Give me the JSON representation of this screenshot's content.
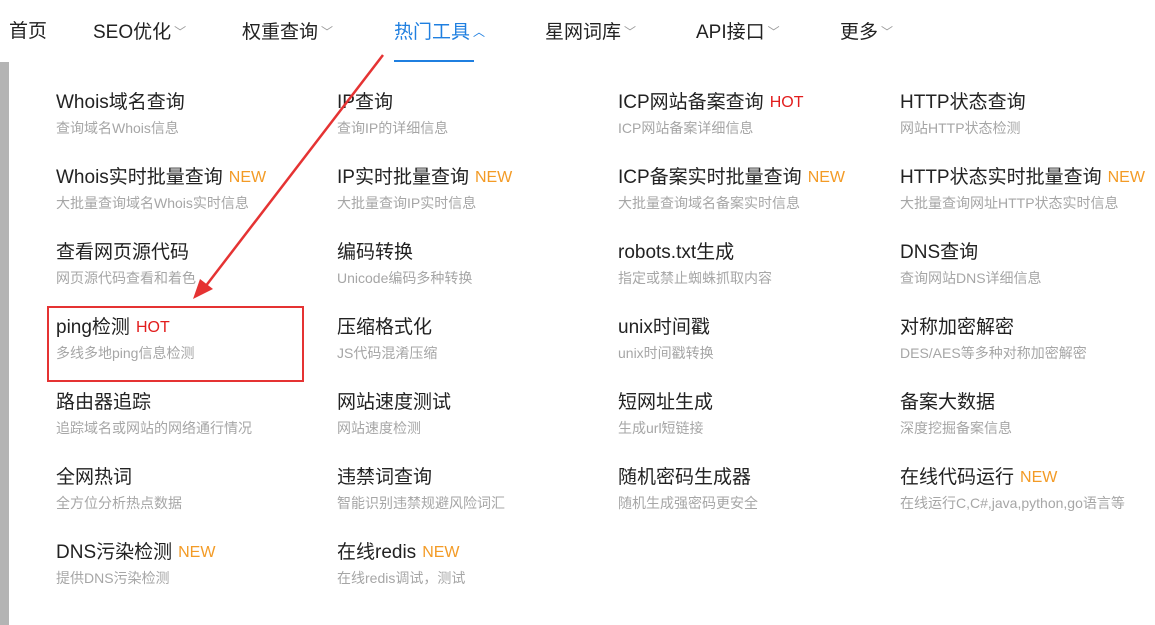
{
  "nav": {
    "items": [
      {
        "label": "首页",
        "chevron": ""
      },
      {
        "label": "SEO优化",
        "chevron": "﹀"
      },
      {
        "label": "权重查询",
        "chevron": "﹀"
      },
      {
        "label": "热门工具",
        "chevron": "︿"
      },
      {
        "label": "星网词库",
        "chevron": "﹀"
      },
      {
        "label": "API接口",
        "chevron": "﹀"
      },
      {
        "label": "更多",
        "chevron": "﹀"
      }
    ],
    "active": "热门工具"
  },
  "tools": [
    {
      "title": "Whois域名查询",
      "badge": "",
      "desc": "查询域名Whois信息"
    },
    {
      "title": "IP查询",
      "badge": "",
      "desc": "查询IP的详细信息"
    },
    {
      "title": "ICP网站备案查询",
      "badge": "HOT",
      "desc": "ICP网站备案详细信息"
    },
    {
      "title": "HTTP状态查询",
      "badge": "",
      "desc": "网站HTTP状态检测"
    },
    {
      "title": "Whois实时批量查询",
      "badge": "NEW",
      "desc": "大批量查询域名Whois实时信息"
    },
    {
      "title": "IP实时批量查询",
      "badge": "NEW",
      "desc": "大批量查询IP实时信息"
    },
    {
      "title": "ICP备案实时批量查询",
      "badge": "NEW",
      "desc": "大批量查询域名备案实时信息"
    },
    {
      "title": "HTTP状态实时批量查询",
      "badge": "NEW",
      "desc": "大批量查询网址HTTP状态实时信息"
    },
    {
      "title": "查看网页源代码",
      "badge": "",
      "desc": "网页源代码查看和着色"
    },
    {
      "title": "编码转换",
      "badge": "",
      "desc": "Unicode编码多种转换"
    },
    {
      "title": "robots.txt生成",
      "badge": "",
      "desc": "指定或禁止蜘蛛抓取内容"
    },
    {
      "title": "DNS查询",
      "badge": "",
      "desc": "查询网站DNS详细信息"
    },
    {
      "title": "ping检测",
      "badge": "HOT",
      "desc": "多线多地ping信息检测"
    },
    {
      "title": "压缩格式化",
      "badge": "",
      "desc": "JS代码混淆压缩"
    },
    {
      "title": "unix时间戳",
      "badge": "",
      "desc": "unix时间戳转换"
    },
    {
      "title": "对称加密解密",
      "badge": "",
      "desc": "DES/AES等多种对称加密解密"
    },
    {
      "title": "路由器追踪",
      "badge": "",
      "desc": "追踪域名或网站的网络通行情况"
    },
    {
      "title": "网站速度测试",
      "badge": "",
      "desc": "网站速度检测"
    },
    {
      "title": "短网址生成",
      "badge": "",
      "desc": "生成url短链接"
    },
    {
      "title": "备案大数据",
      "badge": "",
      "desc": "深度挖掘备案信息"
    },
    {
      "title": "全网热词",
      "badge": "",
      "desc": "全方位分析热点数据"
    },
    {
      "title": "违禁词查询",
      "badge": "",
      "desc": "智能识别违禁规避风险词汇"
    },
    {
      "title": "随机密码生成器",
      "badge": "",
      "desc": "随机生成强密码更安全"
    },
    {
      "title": "在线代码运行",
      "badge": "NEW",
      "desc": "在线运行C,C#,java,python,go语言等"
    },
    {
      "title": "DNS污染检测",
      "badge": "NEW",
      "desc": "提供DNS污染检测"
    },
    {
      "title": "在线redis",
      "badge": "NEW",
      "desc": "在线redis调试，测试"
    }
  ],
  "annotation": {
    "color": "#e53333",
    "target": "ping检测"
  }
}
